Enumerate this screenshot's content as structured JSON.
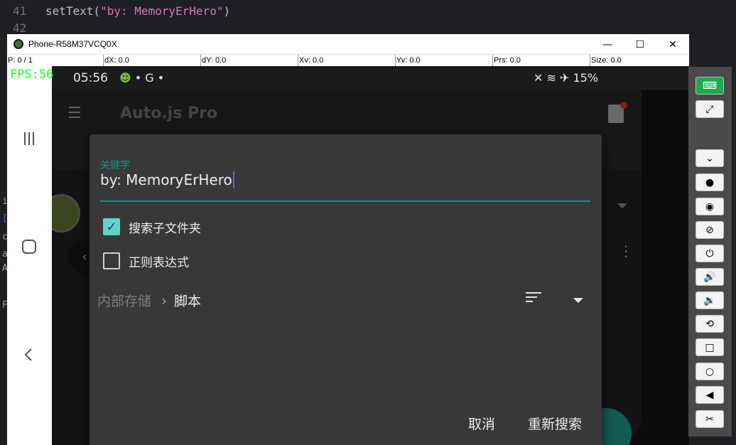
{
  "editor": {
    "lines": [
      {
        "num": "41",
        "prefix": "setText(",
        "string": "\"by: MemoryErHero\"",
        "suffix": ")"
      },
      {
        "num": "42",
        "prefix": "",
        "string": "",
        "suffix": ""
      }
    ],
    "left_edge_chars": [
      "i",
      "[",
      "c",
      "a",
      "A",
      "F"
    ]
  },
  "window": {
    "title": "Phone-R58M37VCQ0X",
    "minimize": "—",
    "maximize": "☐",
    "close": "✕"
  },
  "pointer": {
    "p": "P: 0 / 1",
    "dx": "dX: 0.0",
    "dy": "dY: 0.0",
    "xv": "Xv: 0.0",
    "yv": "Yv: 0.0",
    "prs": "Prs: 0.0",
    "size": "Size: 0.0",
    "fps": "FPS:56"
  },
  "status_bar": {
    "time": "05:56",
    "left_icons": "• G •",
    "battery": "15%"
  },
  "app": {
    "title": "Auto.js Pro"
  },
  "dialog": {
    "keyword_label": "关键字",
    "keyword_value": "by: MemoryErHero",
    "options": [
      {
        "label": "搜索子文件夹",
        "checked": true
      },
      {
        "label": "正则表达式",
        "checked": false
      }
    ],
    "breadcrumb_root": "内部存储",
    "breadcrumb_current": "脚本",
    "cancel": "取消",
    "research": "重新搜索"
  },
  "toolbar": {
    "buttons": [
      "keyboard-icon",
      "fullscreen-icon",
      "expand-icon",
      "record-icon",
      "eye-icon",
      "eye-off-icon",
      "power-icon",
      "volume-up-icon",
      "volume-down-icon",
      "rotate-icon",
      "home-square-icon",
      "recents-icon",
      "back-icon",
      "screenshot-icon"
    ]
  },
  "colors": {
    "accent": "#1f8c82",
    "checkbox": "#5fd4c6",
    "dialog_bg": "#383838",
    "fps": "#1eff1e",
    "string": "#c77dbb"
  }
}
